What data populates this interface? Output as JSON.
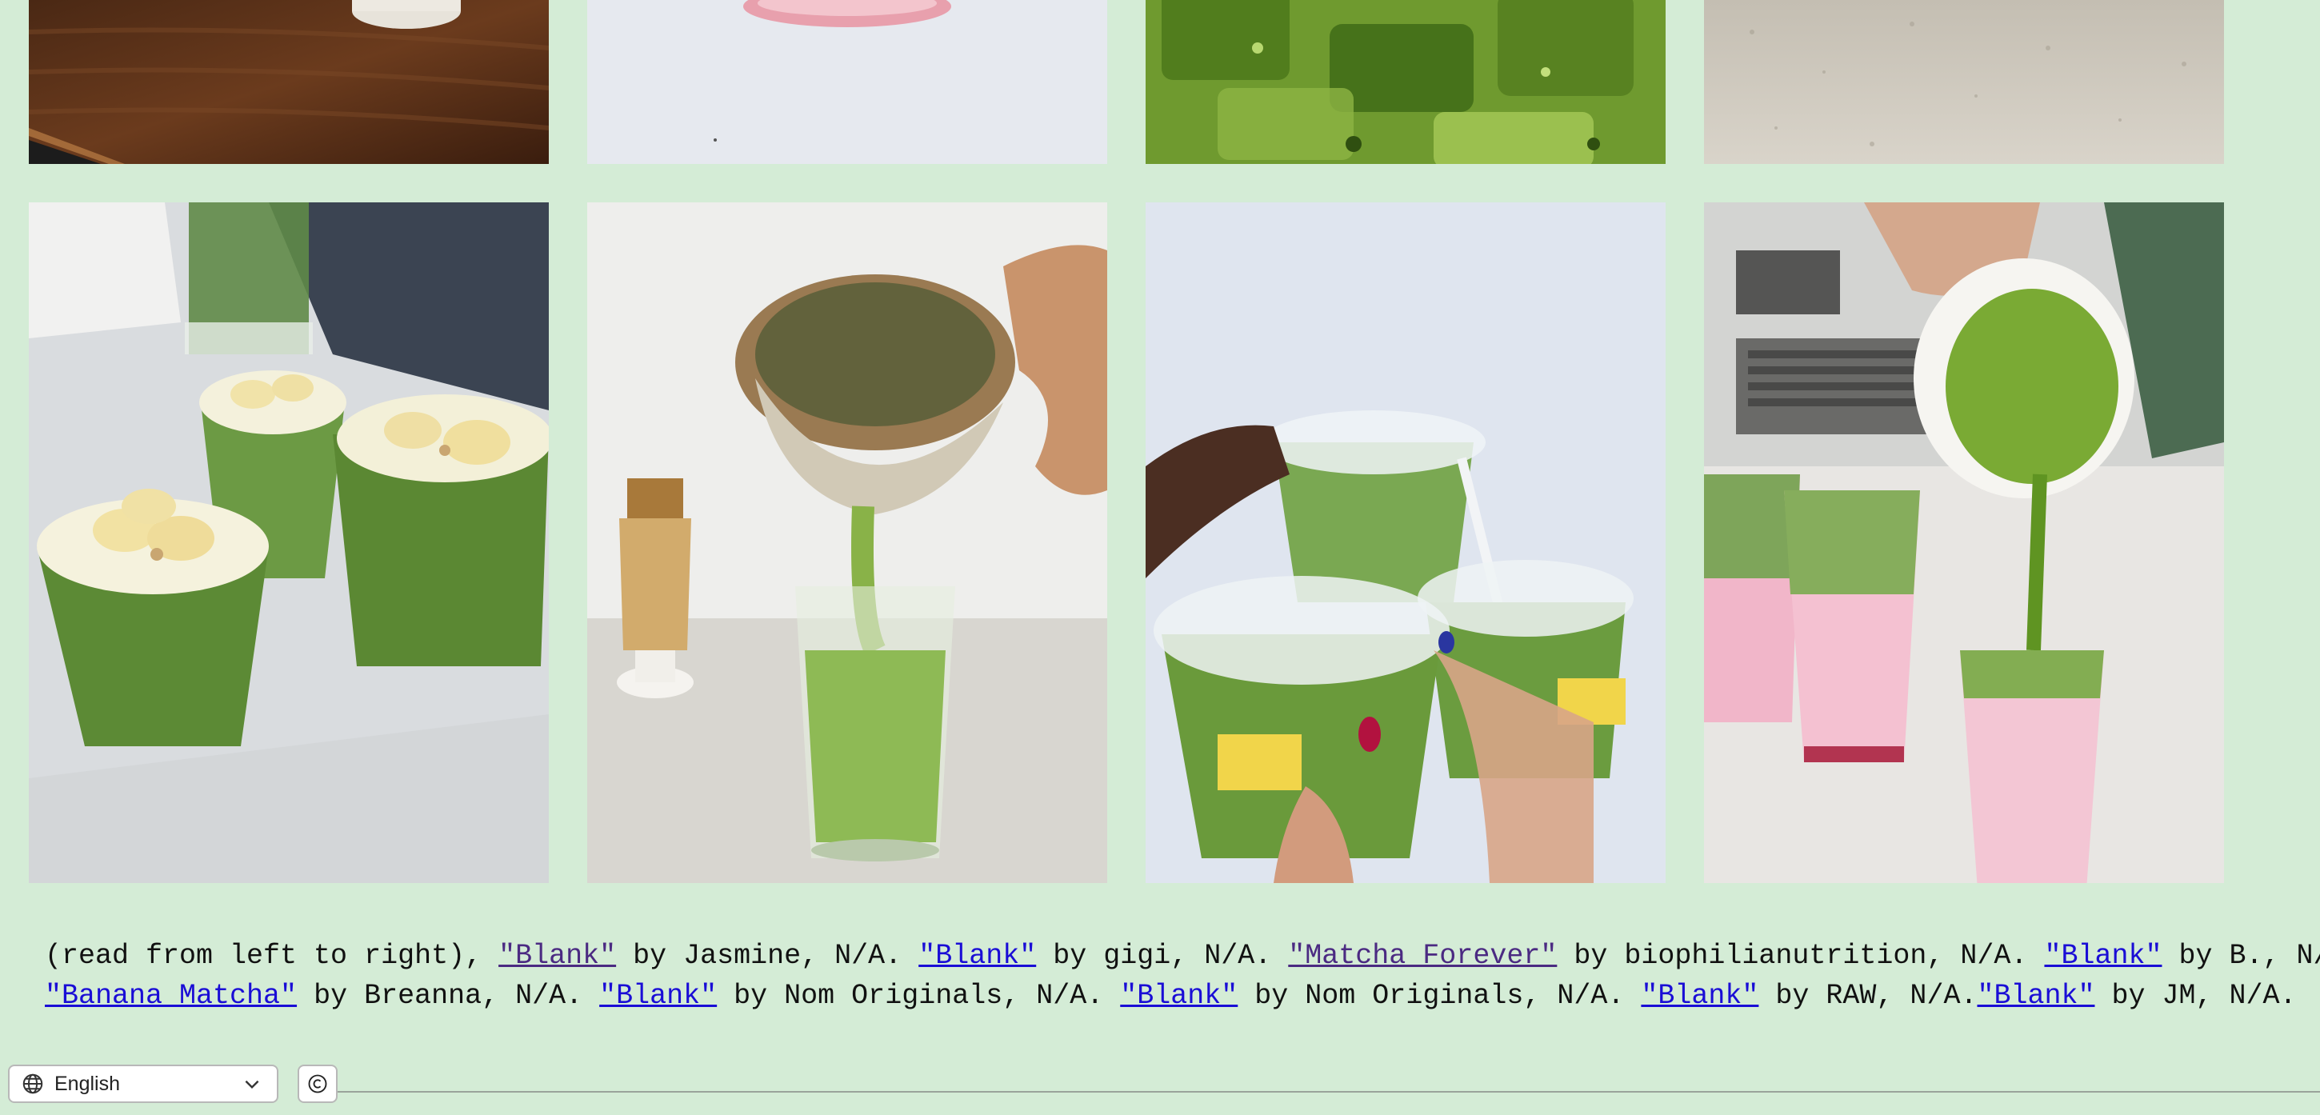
{
  "gallery": {
    "images": [
      {
        "name": "photo-wooden-table-cup"
      },
      {
        "name": "photo-pink-bowl"
      },
      {
        "name": "photo-iced-matcha-closeup"
      },
      {
        "name": "photo-speckled-counter"
      },
      {
        "name": "photo-banana-matcha-cups"
      },
      {
        "name": "photo-matcha-pour-bowl"
      },
      {
        "name": "photo-community-goods-matcha"
      },
      {
        "name": "photo-strawberry-matcha-pour"
      }
    ]
  },
  "credits": {
    "intro": "(read from left to right), ",
    "entries": [
      {
        "title": "\"Blank\"",
        "byline": " by Jasmine, N/A. "
      },
      {
        "title": "\"Blank\"",
        "byline": " by gigi, N/A. "
      },
      {
        "title": "\"Matcha Forever\"",
        "byline": " by biophilianutrition, N/A. "
      },
      {
        "title": "\"Blank\"",
        "byline": " by B., N/A."
      },
      {
        "title": "\"Banana Matcha\"",
        "byline": " by Breanna, N/A. "
      },
      {
        "title": "\"Blank\"",
        "byline": " by Nom Originals, N/A. "
      },
      {
        "title": "\"Blank\"",
        "byline": " by Nom Originals, N/A. "
      },
      {
        "title": "\"Blank\"",
        "byline": " by RAW, N/A."
      },
      {
        "title": "\"Blank\"",
        "byline": " by JM, N/A."
      }
    ]
  },
  "footer": {
    "language": "English",
    "globe_icon": "globe-icon",
    "chevron_icon": "chevron-down-icon",
    "copyright_icon": "copyright-icon"
  }
}
